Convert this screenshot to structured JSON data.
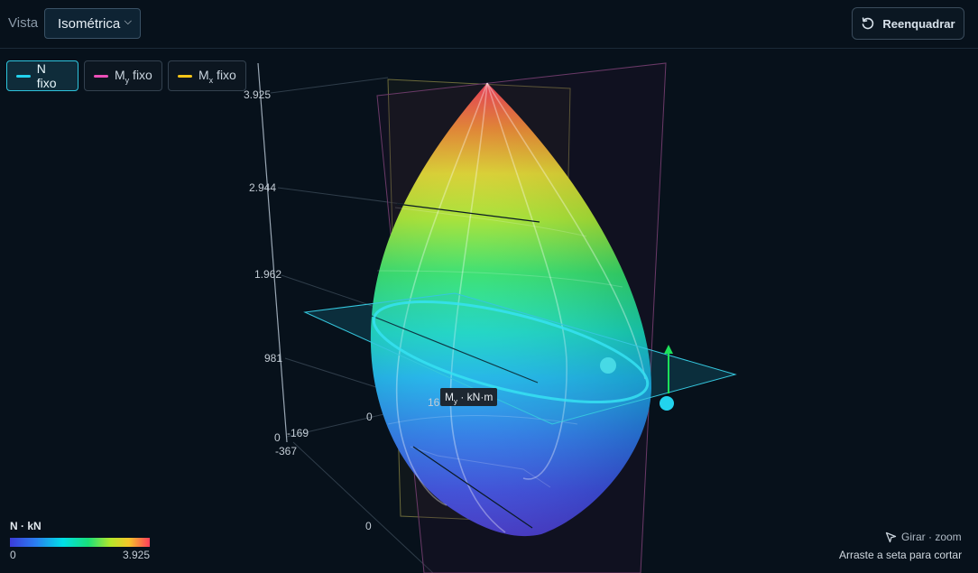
{
  "toolbar": {
    "vista_label": "Vista",
    "vista_value": "Isométrica",
    "reframe_label": "Reenquadrar"
  },
  "chips": [
    {
      "label": "N fixo",
      "color": "#22d3ee",
      "active": true
    },
    {
      "label": "M",
      "sub": "y",
      "suffix": " fixo",
      "color": "#ec4fb8",
      "active": false
    },
    {
      "label": "M",
      "sub": "x",
      "suffix": " fixo",
      "color": "#f5c518",
      "active": false
    }
  ],
  "axes": {
    "n_ticks": [
      "3.925",
      "2.944",
      "1.962",
      "981",
      "0"
    ],
    "my_ticks": [
      "-367",
      "0",
      "169"
    ],
    "mx_ticks": [
      "-169",
      "0"
    ]
  },
  "tooltip": {
    "label": "M",
    "sub": "y",
    "suffix": " · kN·m"
  },
  "legend": {
    "title": "N · kN",
    "min": "0",
    "max": "3.925"
  },
  "hints": {
    "rotate_zoom": "Girar · zoom",
    "cut": "Arraste a seta para cortar"
  },
  "colors": {
    "background": "#07111b",
    "accent": "#22d3ee"
  }
}
